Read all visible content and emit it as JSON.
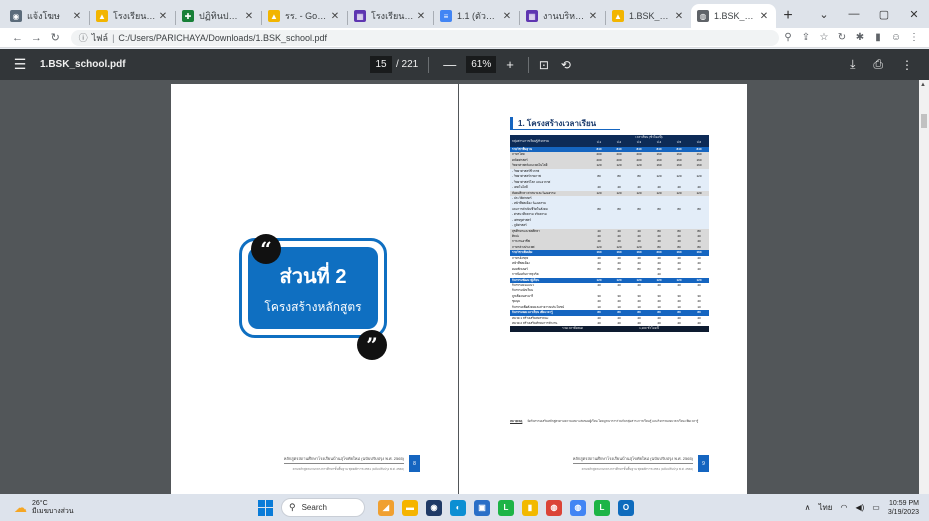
{
  "browser": {
    "tabs": [
      {
        "title": "แจ้งโฆษ",
        "favicon_color": "#5b6b7a",
        "glyph": "◉"
      },
      {
        "title": "โรงเรียนเมือง (",
        "favicon_color": "#f2b500",
        "glyph": "▲"
      },
      {
        "title": "ปฏิทินปฏิบัติงาน",
        "favicon_color": "#188038",
        "glyph": "✚"
      },
      {
        "title": "รร. - Google ไ",
        "favicon_color": "#f2b500",
        "glyph": "▲"
      },
      {
        "title": "โรงเรียนบ้านหุ้ย",
        "favicon_color": "#5e35b1",
        "glyph": "▦"
      },
      {
        "title": "1.1 (ตัวชี้วัด) ร",
        "favicon_color": "#4285f4",
        "glyph": "≡"
      },
      {
        "title": "งานบริหารวิชาก",
        "favicon_color": "#5e35b1",
        "glyph": "▦"
      },
      {
        "title": "1.BSK_school",
        "favicon_color": "#f2b500",
        "glyph": "▲"
      },
      {
        "title": "1.BSK_school",
        "favicon_color": "#5f6368",
        "glyph": "◍",
        "active": true
      }
    ],
    "new_tab_label": "+",
    "window_controls": [
      "⌄",
      "—",
      "▢",
      "✕"
    ],
    "address": {
      "info_label": "ไฟล์",
      "url": "C:/Users/PARICHAYA/Downloads/1.BSK_school.pdf"
    }
  },
  "pdf_toolbar": {
    "file_name": "1.BSK_school.pdf",
    "current_page": "15",
    "total_pages": "/ 221",
    "zoom_out": "—",
    "zoom": "61%",
    "zoom_in": "+"
  },
  "left_page": {
    "cover_title": "ส่วนที่ 2",
    "cover_subtitle": "โครงสร้างหลักสูตร",
    "open_quote": "“",
    "close_quote": "”",
    "footer_line1": "หลักสูตรสถานศึกษาโรงเรียนบ้านสุโขทัยใหม่ (ฉบับปรับปรุง พ.ศ. 2565)",
    "footer_line2": "ตามหลักสูตรแกนกลางการศึกษาขั้นพื้นฐาน พุทธศักราช 2551 (ฉบับปรับปรุง พ.ศ. 2560)",
    "page_num": "8"
  },
  "right_page": {
    "section_title": "1. โครงสร้างเวลาเรียน",
    "table": {
      "header_col": "กลุ่มสาระการเรียนรู้/กิจกรรม",
      "header_group": "เวลาเรียน (ชั่วโมง/ปี)",
      "grades": [
        "ป.1",
        "ป.2",
        "ป.3",
        "ป.4",
        "ป.5",
        "ป.6"
      ],
      "rows": [
        {
          "label": "รายวิชาพื้นฐาน",
          "vals": [
            "840",
            "840",
            "840",
            "840",
            "840",
            "840"
          ],
          "style": "blue"
        },
        {
          "label": "ภาษาไทย",
          "vals": [
            "200",
            "200",
            "200",
            "160",
            "160",
            "160"
          ],
          "style": "grey"
        },
        {
          "label": "คณิตศาสตร์",
          "vals": [
            "200",
            "200",
            "200",
            "160",
            "160",
            "160"
          ],
          "style": "grey"
        },
        {
          "label": "วิทยาศาสตร์และเทคโนโลยี",
          "vals": [
            "120",
            "120",
            "120",
            "160",
            "160",
            "160"
          ],
          "style": "grey"
        },
        {
          "label": " - วิทยาศาสตร์ชีวภาพ",
          "vals": [
            "",
            "",
            "",
            "",
            "",
            ""
          ],
          "style": "light"
        },
        {
          "label": " - วิทยาศาสตร์กายภาพ",
          "vals": [
            "80",
            "80",
            "80",
            "120",
            "120",
            "120"
          ],
          "style": "light"
        },
        {
          "label": " - วิทยาศาสตร์โลก และอวกาศ",
          "vals": [
            "",
            "",
            "",
            "",
            "",
            ""
          ],
          "style": "light"
        },
        {
          "label": " - เทคโนโลยี",
          "vals": [
            "40",
            "40",
            "40",
            "40",
            "40",
            "40"
          ],
          "style": "light"
        },
        {
          "label": "สังคมศึกษา ศาสนาและวัฒนธรรม",
          "vals": [
            "120",
            "120",
            "120",
            "120",
            "120",
            "120"
          ],
          "style": "grey"
        },
        {
          "label": " - ประวัติศาสตร์",
          "vals": [
            "",
            "",
            "",
            "",
            "",
            ""
          ],
          "style": "light"
        },
        {
          "label": " - หน้าที่พลเมือง วัฒนธรรม",
          "vals": [
            "",
            "",
            "",
            "",
            "",
            ""
          ],
          "style": "light"
        },
        {
          "label": "   และการดำเนินชีวิตในสังคม",
          "vals": [
            "80",
            "80",
            "80",
            "80",
            "80",
            "80"
          ],
          "style": "light"
        },
        {
          "label": " - ศาสนาศีลธรรม จริยธรรม",
          "vals": [
            "",
            "",
            "",
            "",
            "",
            ""
          ],
          "style": "light"
        },
        {
          "label": " - เศรษฐศาสตร์",
          "vals": [
            "",
            "",
            "",
            "",
            "",
            ""
          ],
          "style": "light"
        },
        {
          "label": " - ภูมิศาสตร์",
          "vals": [
            "",
            "",
            "",
            "",
            "",
            ""
          ],
          "style": "light"
        },
        {
          "label": "สุขศึกษาและพลศึกษา",
          "vals": [
            "40",
            "40",
            "40",
            "80",
            "80",
            "80"
          ],
          "style": "grey"
        },
        {
          "label": "ศิลปะ",
          "vals": [
            "40",
            "40",
            "40",
            "40",
            "40",
            "40"
          ],
          "style": "grey"
        },
        {
          "label": "การงานอาชีพ",
          "vals": [
            "40",
            "40",
            "40",
            "40",
            "40",
            "40"
          ],
          "style": "grey"
        },
        {
          "label": "ภาษาต่างประเทศ",
          "vals": [
            "120",
            "120",
            "120",
            "80",
            "80",
            "80"
          ],
          "style": "grey"
        },
        {
          "label": "รายวิชาเพิ่มเติม",
          "vals": [
            "160",
            "160",
            "160",
            "200",
            "160",
            "160"
          ],
          "style": "blue"
        },
        {
          "label": "ภาษาอังกฤษ",
          "vals": [
            "40",
            "40",
            "40",
            "40",
            "40",
            "40"
          ],
          "style": "white"
        },
        {
          "label": "หน้าที่พลเมือง",
          "vals": [
            "40",
            "40",
            "40",
            "40",
            "40",
            "40"
          ],
          "style": "white"
        },
        {
          "label": "คอมพิวเตอร์",
          "vals": [
            "80",
            "80",
            "80",
            "80",
            "40",
            "40"
          ],
          "style": "white"
        },
        {
          "label": "การป้องกันการทุจริต",
          "vals": [
            "",
            "",
            "",
            "40",
            "",
            ""
          ],
          "style": "white"
        },
        {
          "label": "กิจกรรมพัฒนาผู้เรียน",
          "vals": [
            "120",
            "120",
            "120",
            "120",
            "120",
            "120"
          ],
          "style": "blue"
        },
        {
          "label": "กิจกรรมแนะแนว",
          "vals": [
            "40",
            "40",
            "40",
            "40",
            "40",
            "40"
          ],
          "style": "white"
        },
        {
          "label": "กิจกรรมนักเรียน",
          "vals": [
            "",
            "",
            "",
            "",
            "",
            ""
          ],
          "style": "white"
        },
        {
          "label": "ลูกเสือ/เนตรนารี",
          "vals": [
            "30",
            "30",
            "30",
            "30",
            "30",
            "30"
          ],
          "style": "white"
        },
        {
          "label": "ชุมนุม",
          "vals": [
            "40",
            "40",
            "40",
            "40",
            "40",
            "40"
          ],
          "style": "white"
        },
        {
          "label": "กิจกรรมเพื่อสังคมและสาธารณประโยชน์",
          "vals": [
            "10",
            "10",
            "10",
            "10",
            "10",
            "10"
          ],
          "style": "white"
        },
        {
          "label": "กิจกรรมลดเวลาเรียน เพิ่มเวลารู้",
          "vals": [
            "80",
            "80",
            "80",
            "80",
            "80",
            "80"
          ],
          "style": "blue"
        },
        {
          "label": "หมวด 1 สร้างเสริมสมรรถนะ",
          "vals": [
            "40",
            "40",
            "40",
            "40",
            "40",
            "40"
          ],
          "style": "white"
        },
        {
          "label": "หมวด 2 สร้างเสริมทักษะการทำงาน",
          "vals": [
            "40",
            "40",
            "40",
            "40",
            "40",
            "40"
          ],
          "style": "white"
        }
      ],
      "total_label": "รวมเวลาทั้งหมด",
      "total_value": "1,200 ชั่วโมง/ปี"
    },
    "note_label": "หมายเหตุ",
    "note_text": "จัดกิจกรรมเสริมหลักสูตรตามความเหมาะสมของผู้เรียน โดยบูรณาการร่วมกับกลุ่มสาระการเรียนรู้ และกิจกรรมลดเวลาเรียน เพิ่มเวลารู้",
    "footer_line1": "หลักสูตรสถานศึกษาโรงเรียนบ้านสุโขทัยใหม่ (ฉบับปรับปรุง พ.ศ. 2565)",
    "footer_line2": "ตามหลักสูตรแกนกลางการศึกษาขั้นพื้นฐาน พุทธศักราช 2551 (ฉบับปรับปรุง พ.ศ. 2560)",
    "page_num": "9"
  },
  "taskbar": {
    "temperature": "26°C",
    "weather_text": "มีเมฆบางส่วน",
    "search_label": "Search",
    "apps": [
      {
        "name": "app-widgets",
        "color": "#f0a030",
        "glyph": "◢"
      },
      {
        "name": "app-files",
        "color": "#f5b400",
        "glyph": "▬"
      },
      {
        "name": "app-chrome-dark",
        "color": "#1f3a66",
        "glyph": "◉"
      },
      {
        "name": "app-edge",
        "color": "#0c8fd3",
        "glyph": "◐"
      },
      {
        "name": "app-store",
        "color": "#2a6fc7",
        "glyph": "▣"
      },
      {
        "name": "app-line",
        "color": "#1db446",
        "glyph": "L"
      },
      {
        "name": "app-explorer",
        "color": "#f2b900",
        "glyph": "▮"
      },
      {
        "name": "app-chrome",
        "color": "#db4437",
        "glyph": "◍"
      },
      {
        "name": "app-chrome-2",
        "color": "#4285f4",
        "glyph": "◍"
      },
      {
        "name": "app-line-2",
        "color": "#1db446",
        "glyph": "L"
      },
      {
        "name": "app-outlook",
        "color": "#0f6cbd",
        "glyph": "O"
      }
    ],
    "tray_lang": "ไทย",
    "time": "10:59 PM",
    "date": "3/19/2023"
  }
}
